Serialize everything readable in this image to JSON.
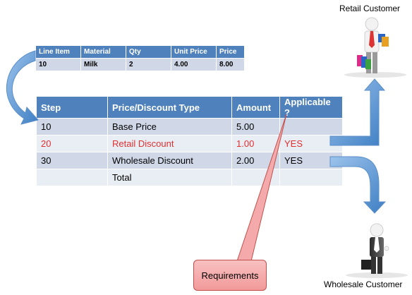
{
  "line_item_table": {
    "headers": [
      "Line Item",
      "Material",
      "Qty",
      "Unit Price",
      "Price"
    ],
    "row": [
      "10",
      "Milk",
      "2",
      "4.00",
      "8.00"
    ]
  },
  "pricing_table": {
    "headers": [
      "Step",
      "Price/Discount Type",
      "Amount",
      "Applicable ?"
    ],
    "rows": [
      [
        "10",
        "Base Price",
        "5.00",
        ""
      ],
      [
        "20",
        "Retail Discount",
        "1.00",
        "YES"
      ],
      [
        "30",
        "Wholesale Discount",
        "2.00",
        "YES"
      ],
      [
        "",
        "Total",
        "",
        ""
      ]
    ],
    "highlight_color": "#e03030"
  },
  "labels": {
    "retail_customer": "Retail Customer",
    "wholesale_customer": "Wholesale Customer",
    "requirements": "Requirements"
  },
  "colors": {
    "header_blue": "#4f81bd",
    "row_light": "#d0d8e8",
    "row_lighter": "#e9edf4",
    "arrow_blue": "#5b9bd5",
    "callout_red": "#f29a9a"
  },
  "icons": [
    "retail-customer-figure",
    "wholesale-customer-figure",
    "curved-arrow"
  ]
}
